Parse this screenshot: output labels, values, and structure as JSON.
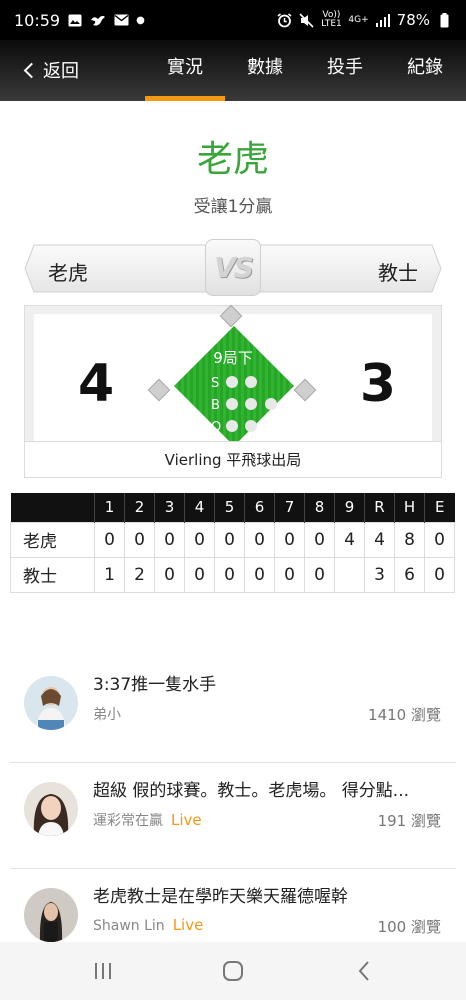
{
  "status": {
    "time": "10:59",
    "battery": "78%",
    "net_top": "4G+",
    "lte_label": "Vo)) LTE1"
  },
  "nav": {
    "back_label": "返回",
    "tabs": [
      "實況",
      "數據",
      "投手",
      "紀錄"
    ],
    "active_tab": 0
  },
  "result": {
    "winner": "老虎",
    "handicap": "受讓1分贏"
  },
  "matchup": {
    "left_team": "老虎",
    "right_team": "教士",
    "vs_label": "VS"
  },
  "score": {
    "left": "4",
    "right": "3",
    "inning": "9局下",
    "sbo_labels": [
      "S",
      "B",
      "O"
    ],
    "last_play": "Vierling 平飛球出局"
  },
  "linescore": {
    "headers": [
      "",
      "1",
      "2",
      "3",
      "4",
      "5",
      "6",
      "7",
      "8",
      "9",
      "R",
      "H",
      "E"
    ],
    "rows": [
      [
        "老虎",
        "0",
        "0",
        "0",
        "0",
        "0",
        "0",
        "0",
        "0",
        "4",
        "4",
        "8",
        "0"
      ],
      [
        "教士",
        "1",
        "2",
        "0",
        "0",
        "0",
        "0",
        "0",
        "0",
        "",
        "3",
        "6",
        "0"
      ]
    ]
  },
  "posts": [
    {
      "title": "3:37推一隻水手",
      "author": "弟小",
      "live": "",
      "views": "1410 瀏覽"
    },
    {
      "title": "超級 假的球賽。教士。老虎場。 得分點...",
      "author": "運彩常在贏",
      "live": "Live",
      "views": "191 瀏覽"
    },
    {
      "title": "老虎教士是在學昨天樂天羅德喔幹",
      "author": "Shawn Lin",
      "live": "Live",
      "views": "100 瀏覽"
    }
  ],
  "colors": {
    "accent": "#f39a12",
    "winner_green": "#3aa53a",
    "field_green": "#2fb52f"
  }
}
